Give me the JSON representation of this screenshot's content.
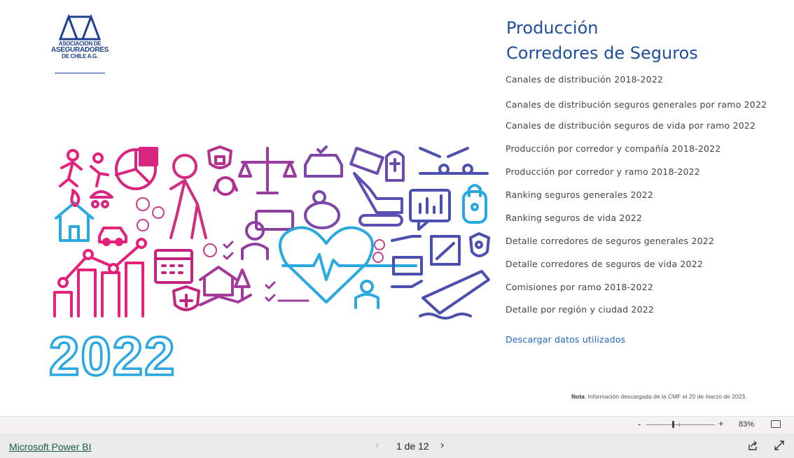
{
  "report": {
    "title_line1": "Producción",
    "title_line2": "Corredores de Seguros",
    "year": "2022",
    "logo": {
      "line1": "ASOCIACION DE",
      "line2": "ASEGURADORES",
      "line3": "DE CHILE A.G."
    },
    "menu": [
      "Canales de distribución 2018-2022",
      "Canales de distribución seguros generales por ramo 2022",
      "Canales de distribución seguros de vida por ramo 2022",
      "Producción por corredor y compañía 2018-2022",
      "Producción por corredor y ramo 2018-2022",
      "Ranking seguros generales 2022",
      "Ranking seguros de vida 2022",
      "Detalle corredores de seguros generales 2022",
      "Detalle corredores de seguros de vida 2022",
      "Comisiones por ramo 2018-2022",
      "Detalle por región y ciudad 2022"
    ],
    "download_label": "Descargar datos utilizados",
    "note_label": "Nota",
    "note_text": ": Información descargada de la CMF el 20 de marzo de 2023."
  },
  "zoom": {
    "minus": "-",
    "plus": "+",
    "percent": "83%"
  },
  "footer": {
    "brand": "Microsoft Power BI",
    "pages": "1 de 12",
    "prev_icon": "chevron-left",
    "next_icon": "chevron-right"
  },
  "colors": {
    "title": "#1e4e9c",
    "link": "#2166c8",
    "magenta": "#e6217a",
    "purple": "#7a3fa0",
    "cyan": "#29a9e0",
    "logo": "#1d3f8f"
  }
}
